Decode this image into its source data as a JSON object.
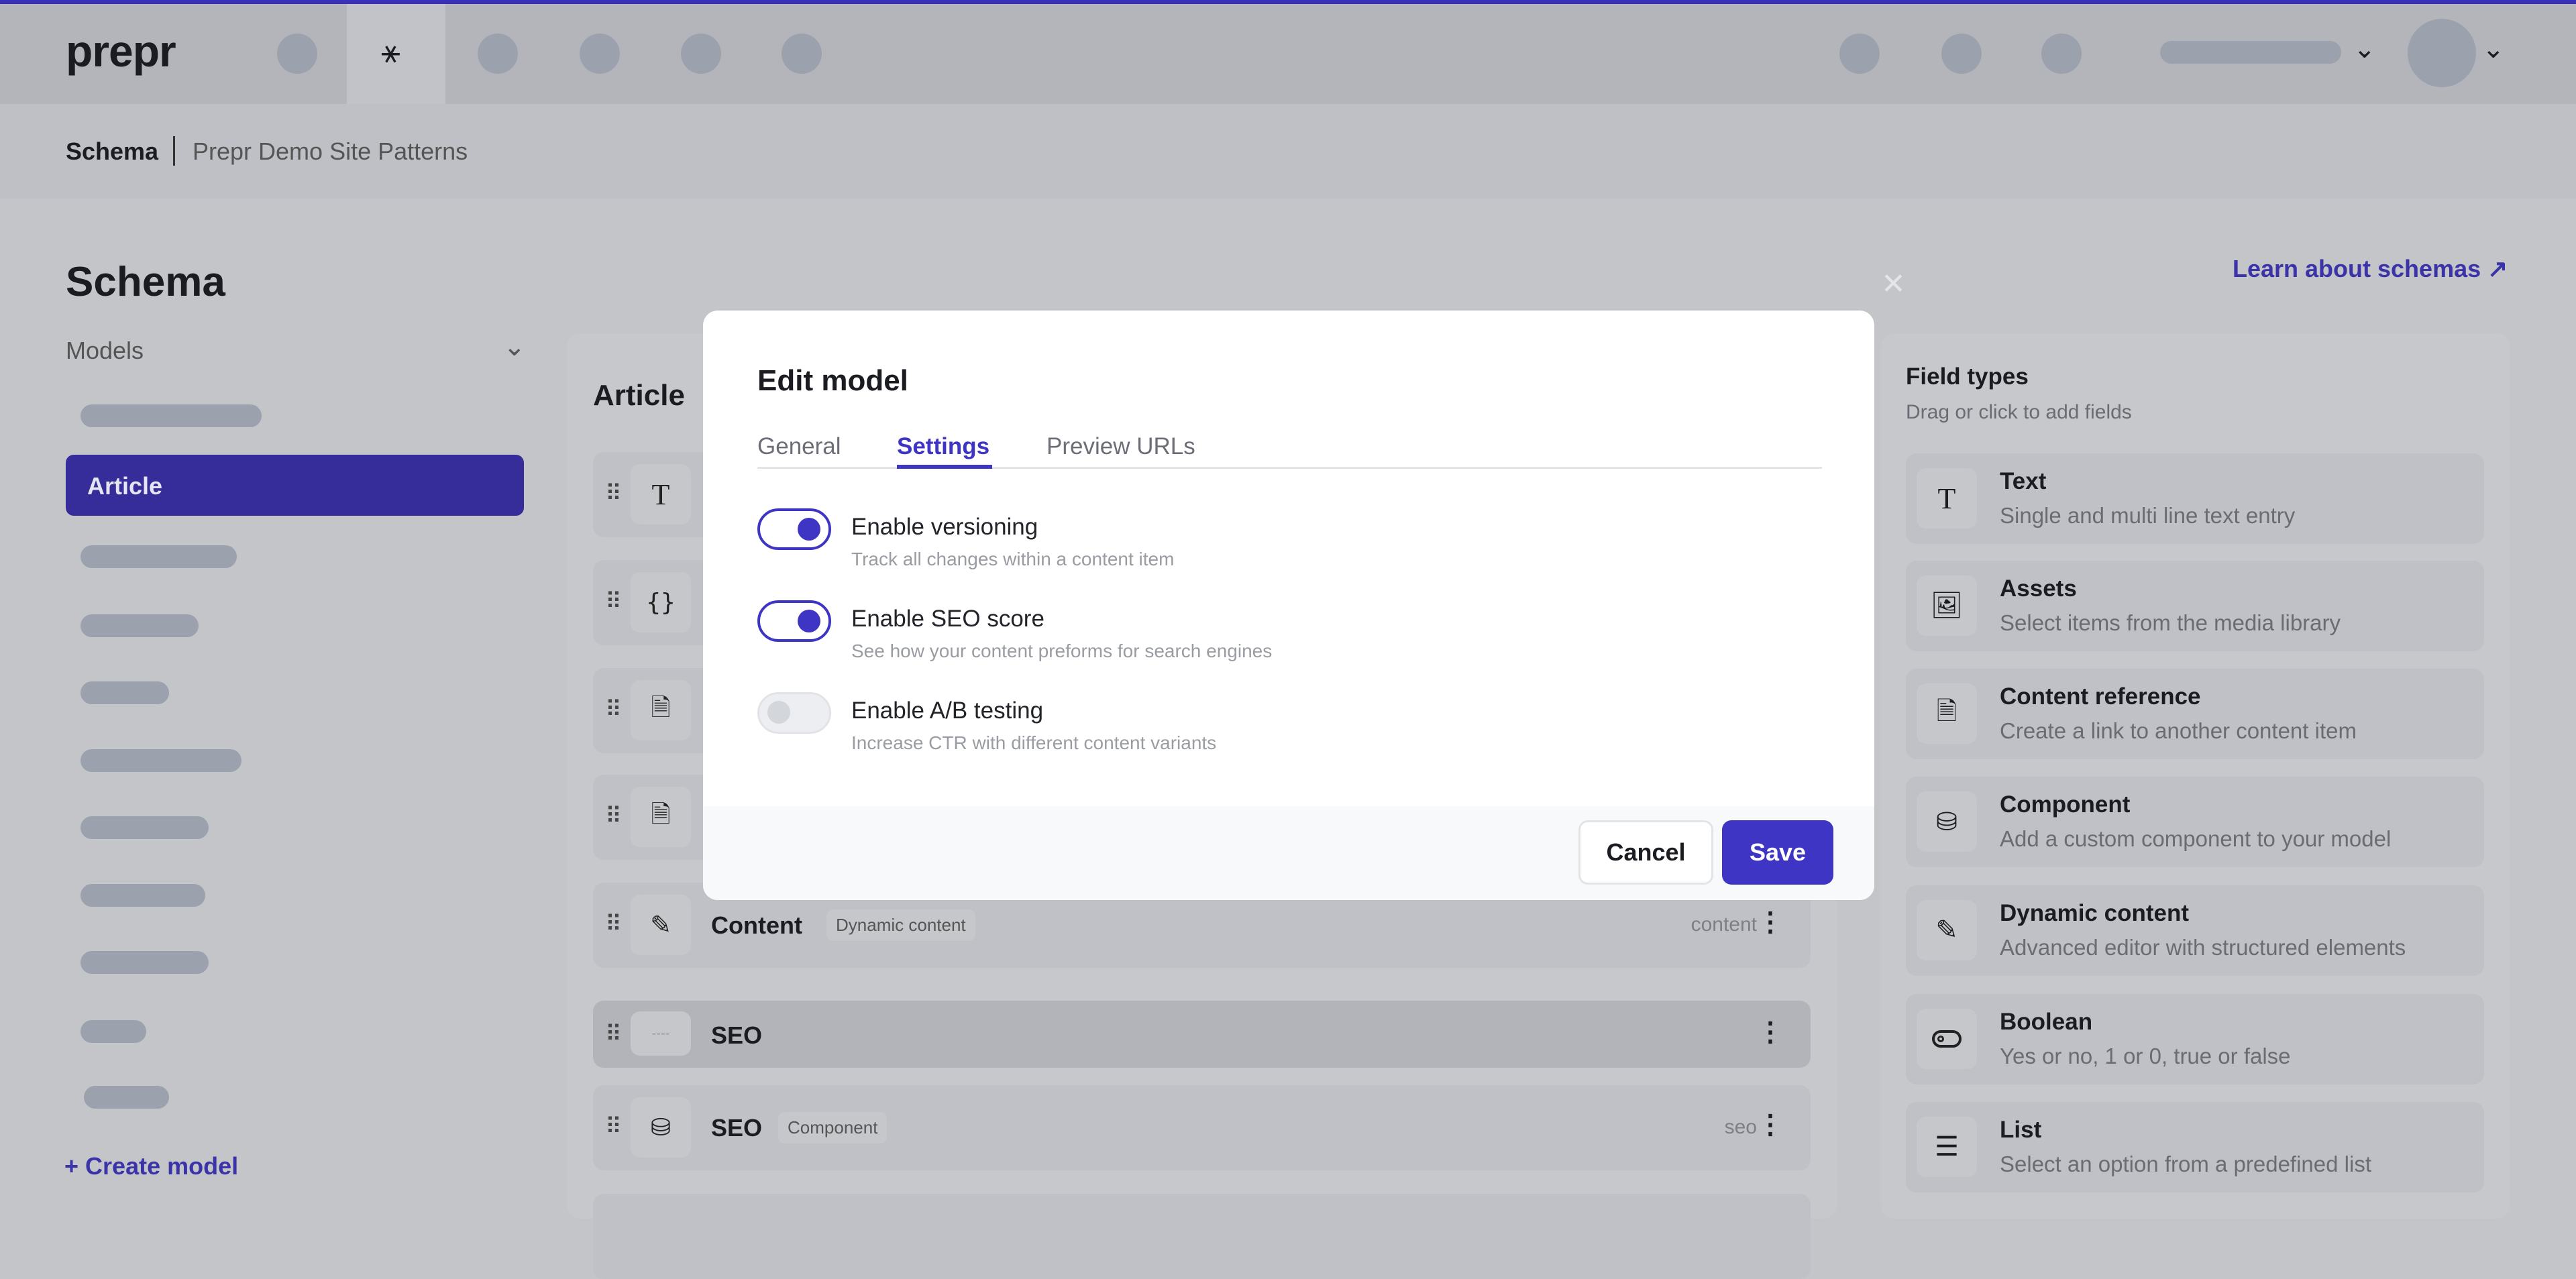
{
  "app": {
    "logo": "prepr",
    "accent": "#3f35c4"
  },
  "breadcrumb": {
    "current": "Schema",
    "project": "Prepr Demo Site Patterns"
  },
  "page": {
    "title": "Schema",
    "learn_link": "Learn about schemas"
  },
  "sidebar": {
    "section": "Models",
    "active_item": "Article",
    "create_label": "Create model"
  },
  "model": {
    "title": "Article",
    "fields": [
      {
        "icon": "text-icon",
        "name": "",
        "tag": "",
        "api": ""
      },
      {
        "icon": "braces-icon",
        "name": "",
        "tag": "",
        "api": ""
      },
      {
        "icon": "document-icon",
        "name": "",
        "tag": "",
        "api": ""
      },
      {
        "icon": "document-icon",
        "name": "",
        "tag": "",
        "api": ""
      },
      {
        "icon": "edit-icon",
        "name": "Content",
        "tag": "Dynamic content",
        "api": "content"
      },
      {
        "icon": "placeholder-icon",
        "name": "SEO",
        "tag": "",
        "api": ""
      },
      {
        "icon": "component-icon",
        "name": "SEO",
        "tag": "Component",
        "api": "seo"
      }
    ]
  },
  "field_types": {
    "title": "Field types",
    "subtitle": "Drag or click to add fields",
    "items": [
      {
        "icon": "text-icon",
        "title": "Text",
        "desc": "Single and multi line text entry"
      },
      {
        "icon": "assets-icon",
        "title": "Assets",
        "desc": "Select items from the media library"
      },
      {
        "icon": "document-icon",
        "title": "Content reference",
        "desc": "Create a link to another content item"
      },
      {
        "icon": "component-icon",
        "title": "Component",
        "desc": "Add a custom component to your model"
      },
      {
        "icon": "edit-icon",
        "title": "Dynamic content",
        "desc": "Advanced editor with structured elements"
      },
      {
        "icon": "toggle-icon",
        "title": "Boolean",
        "desc": "Yes or no, 1 or 0, true or false"
      },
      {
        "icon": "list-icon",
        "title": "List",
        "desc": "Select an option from a predefined list"
      }
    ]
  },
  "modal": {
    "title": "Edit model",
    "tabs": [
      "General",
      "Settings",
      "Preview URLs"
    ],
    "active_tab": "Settings",
    "settings": [
      {
        "label": "Enable versioning",
        "desc": "Track all changes within a content item",
        "enabled": true
      },
      {
        "label": "Enable SEO score",
        "desc": "See how your content preforms for search engines",
        "enabled": true
      },
      {
        "label": "Enable A/B testing",
        "desc": "Increase CTR with different content variants",
        "enabled": false
      }
    ],
    "cancel": "Cancel",
    "save": "Save"
  }
}
